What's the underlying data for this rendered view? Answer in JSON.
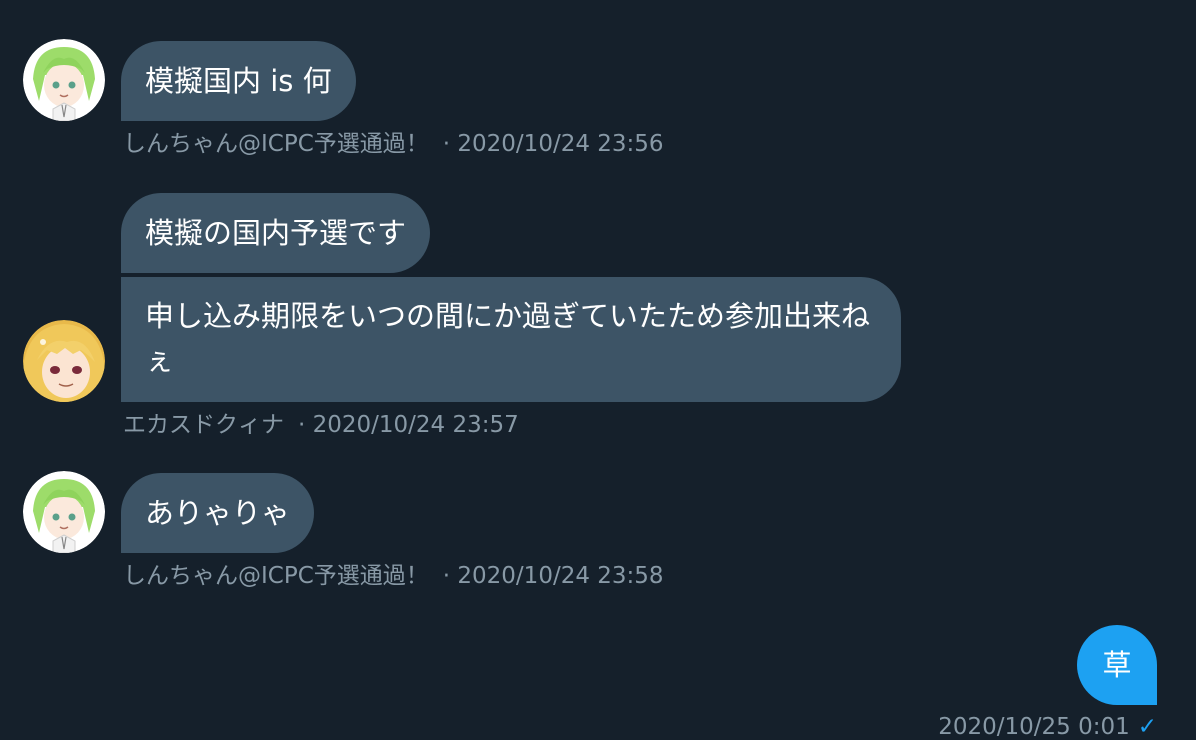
{
  "conversation": {
    "messages": [
      {
        "text": "模擬国内 is 何"
      },
      {
        "text": "模擬の国内予選です"
      },
      {
        "text": "申し込み期限をいつの間にか過ぎていたため参加出来ねぇ"
      },
      {
        "text": "ありゃりゃ"
      },
      {
        "text": "草"
      }
    ],
    "meta": [
      {
        "name": "しんちゃん@ICPC予選通過！",
        "time": "· 2020/10/24 23:56"
      },
      {
        "name": "エカスドクィナ",
        "time": "· 2020/10/24 23:57"
      },
      {
        "name": "しんちゃん@ICPC予選通過！",
        "time": "· 2020/10/24 23:58"
      },
      {
        "time": "2020/10/25 0:01",
        "status": "✓"
      }
    ]
  },
  "colors": {
    "background": "#15202b",
    "incoming_bubble": "#3d5466",
    "outgoing_bubble": "#1da1f2",
    "meta_text": "#8899a6"
  },
  "icons": [
    "avatar-green-hair",
    "avatar-blonde-hair",
    "read-check-icon"
  ]
}
